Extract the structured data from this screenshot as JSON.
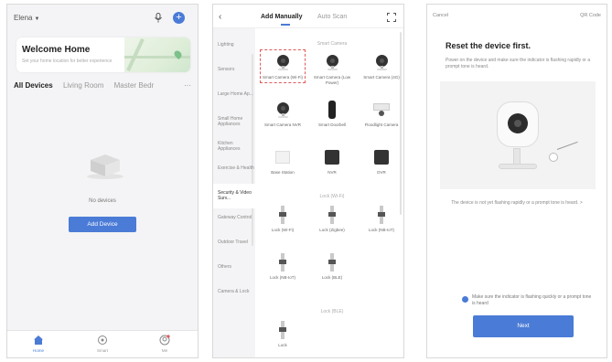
{
  "home_screen": {
    "home_selector": "Elena",
    "welcome_title": "Welcome Home",
    "welcome_subtitle": "Set your home location for better experience",
    "rooms": [
      "All Devices",
      "Living Room",
      "Master Bedr"
    ],
    "active_room": "All Devices",
    "empty_text": "No devices",
    "add_device_label": "Add Device",
    "tabs": [
      {
        "label": "Home",
        "icon": "home-icon",
        "active": true
      },
      {
        "label": "Smart",
        "icon": "smart-scene-icon",
        "active": false
      },
      {
        "label": "Me",
        "icon": "profile-icon",
        "active": false
      }
    ],
    "accent_color": "#4a7bd6"
  },
  "add_device_screen": {
    "tab_manual": "Add Manually",
    "tab_auto": "Auto Scan",
    "categories": [
      "Lighting",
      "Sensors",
      "Large Home Ap...",
      "Small Home Appliances",
      "Kitchen Appliances",
      "Exercise & Health",
      "Security & Video Surv...",
      "Gateway Control",
      "Outdoor Travel",
      "Others",
      "Camera & Lock"
    ],
    "sections": [
      {
        "title": "Smart Camera",
        "devices": [
          {
            "name": "Smart Camera (Wi-Fi)",
            "kind": "camera",
            "selected": true
          },
          {
            "name": "Smart Camera (Low Power)",
            "kind": "camera",
            "selected": false
          },
          {
            "name": "Smart Camera (4G)",
            "kind": "camera",
            "selected": false
          },
          {
            "name": "Smart Camera NVR",
            "kind": "camera",
            "selected": false
          },
          {
            "name": "Smart Doorbell",
            "kind": "doorbell",
            "selected": false
          },
          {
            "name": "Floodlight Camera",
            "kind": "floodlight",
            "selected": false
          },
          {
            "name": "Base Station",
            "kind": "whitebox",
            "selected": false
          },
          {
            "name": "NVR",
            "kind": "darkbox",
            "selected": false
          },
          {
            "name": "DVR",
            "kind": "darkbox",
            "selected": false
          }
        ]
      },
      {
        "title": "Lock (Wi-Fi)",
        "devices": [
          {
            "name": "Lock (Wi-Fi)",
            "kind": "slim",
            "selected": false
          },
          {
            "name": "Lock (Zigbee)",
            "kind": "slim",
            "selected": false
          },
          {
            "name": "Lock (NB-IoT)",
            "kind": "slim",
            "selected": false
          },
          {
            "name": "Lock (NB-IoT)",
            "kind": "slim",
            "selected": false
          },
          {
            "name": "Lock (BLE)",
            "kind": "slim",
            "selected": false
          }
        ]
      },
      {
        "title": "Lock (BLE)",
        "devices": [
          {
            "name": "Lock",
            "kind": "slim",
            "selected": false
          }
        ]
      }
    ],
    "highlight_color": "#e05a5a"
  },
  "reset_screen": {
    "cancel": "Cancel",
    "qr_code": "QR Code",
    "title": "Reset the device first.",
    "description": "Power on the device and make sure the indicator is flashing rapidly or a prompt tone is heard.",
    "link": "The device is not yet flashing rapidly or a prompt tone is heard. >",
    "confirm_text": "Make sure the indicator is flashing quickly or a prompt tone is heard",
    "next_label": "Next",
    "accent_color": "#4a7bd6"
  }
}
